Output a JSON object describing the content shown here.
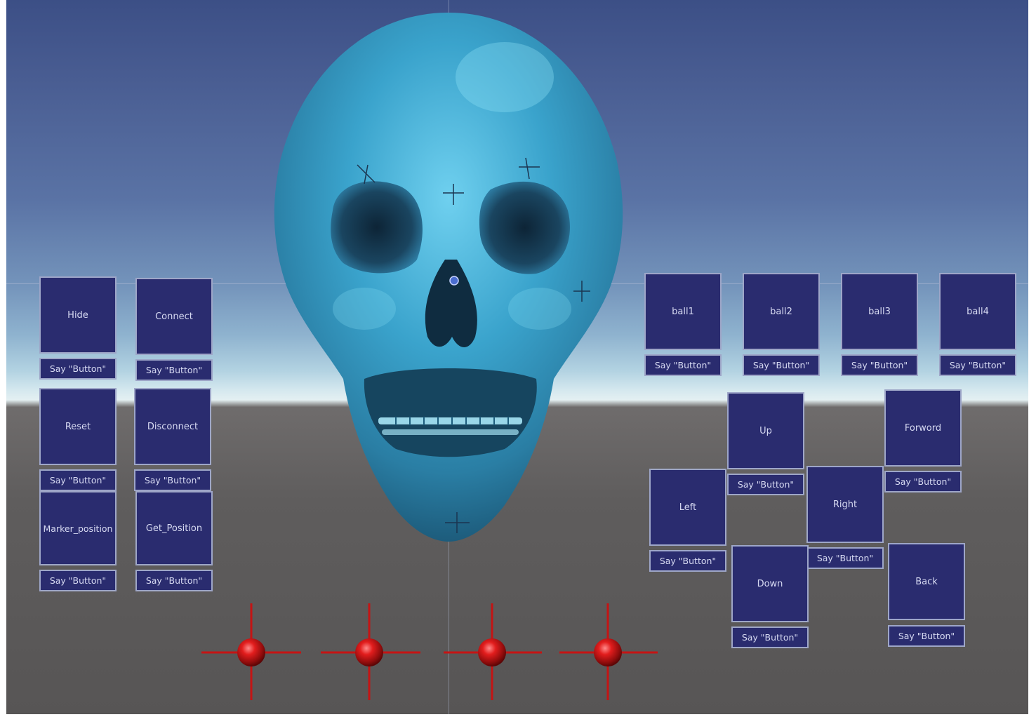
{
  "colors": {
    "button_bg": "#2a2c6f",
    "button_border": "#9ea6c8",
    "button_text": "#d7daf2",
    "skull": "#3aa3cc",
    "marker": "#d01818"
  },
  "left_panel": {
    "hide": {
      "label": "Hide",
      "voice": "Say \"Button\""
    },
    "connect": {
      "label": "Connect",
      "voice": "Say \"Button\""
    },
    "reset": {
      "label": "Reset",
      "voice": "Say \"Button\""
    },
    "disconnect": {
      "label": "Disconnect",
      "voice": "Say \"Button\""
    },
    "marker_position": {
      "label": "Marker_position",
      "voice": "Say \"Button\""
    },
    "get_position": {
      "label": "Get_Position",
      "voice": "Say \"Button\""
    }
  },
  "balls": [
    {
      "label": "ball1",
      "voice": "Say \"Button\""
    },
    {
      "label": "ball2",
      "voice": "Say \"Button\""
    },
    {
      "label": "ball3",
      "voice": "Say \"Button\""
    },
    {
      "label": "ball4",
      "voice": "Say \"Button\""
    }
  ],
  "movement": {
    "up": {
      "label": "Up",
      "voice": "Say \"Button\""
    },
    "forword": {
      "label": "Forword",
      "voice": "Say \"Button\""
    },
    "left": {
      "label": "Left",
      "voice": "Say \"Button\""
    },
    "right": {
      "label": "Right",
      "voice": "Say \"Button\""
    },
    "down": {
      "label": "Down",
      "voice": "Say \"Button\""
    },
    "back": {
      "label": "Back",
      "voice": "Say \"Button\""
    }
  },
  "scene": {
    "model": "skull-icon",
    "marker_icon": "marker-ball-crosshair-icon",
    "marker_count": 4
  }
}
